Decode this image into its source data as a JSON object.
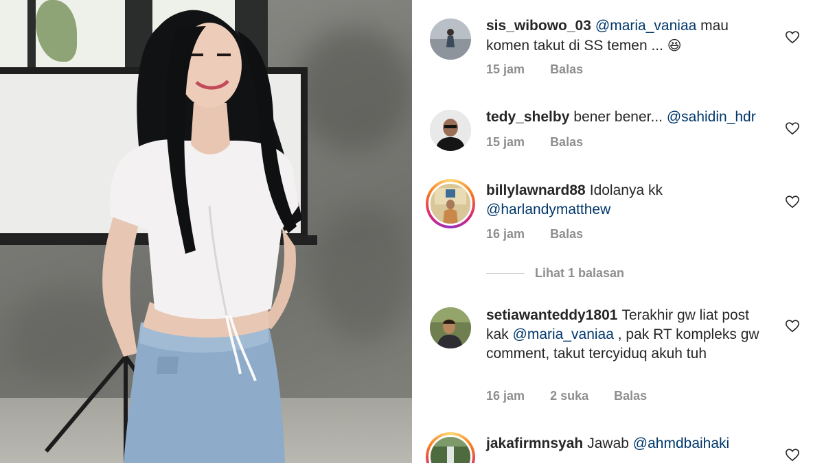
{
  "comments": [
    {
      "username": "sis_wibowo_03",
      "text_parts": [
        {
          "type": "mention",
          "text": "@maria_vaniaa"
        },
        {
          "type": "text",
          "text": " mau komen takut di SS temen ... "
        },
        {
          "type": "emoji",
          "text": "😆"
        }
      ],
      "time": "15 jam",
      "likes": "",
      "reply_label": "Balas",
      "avatar_ring": false
    },
    {
      "username": "tedy_shelby",
      "text_parts": [
        {
          "type": "text",
          "text": "bener bener... "
        },
        {
          "type": "mention",
          "text": "@sahidin_hdr"
        }
      ],
      "time": "15 jam",
      "likes": "",
      "reply_label": "Balas",
      "avatar_ring": false
    },
    {
      "username": "billylawnard88",
      "text_parts": [
        {
          "type": "text",
          "text": "Idolanya kk "
        },
        {
          "type": "mention",
          "text": "@harlandymatthew"
        }
      ],
      "time": "16 jam",
      "likes": "",
      "reply_label": "Balas",
      "avatar_ring": true
    },
    {
      "username": "setiawanteddy1801",
      "text_parts": [
        {
          "type": "text",
          "text": "Terakhir gw liat post kak "
        },
        {
          "type": "mention",
          "text": "@maria_vaniaa"
        },
        {
          "type": "text",
          "text": " , pak RT kompleks gw comment, takut tercyiduq akuh tuh"
        }
      ],
      "time": "16 jam",
      "likes": "2 suka",
      "reply_label": "Balas",
      "avatar_ring": false
    },
    {
      "username": "jakafirmnsyah",
      "text_parts": [
        {
          "type": "text",
          "text": "Jawab "
        },
        {
          "type": "mention",
          "text": "@ahmdbaihaki"
        }
      ],
      "time": "",
      "likes": "",
      "reply_label": "",
      "avatar_ring": true
    }
  ],
  "view_replies": "Lihat 1 balasan",
  "colors": {
    "text": "#262626",
    "mention": "#00376b",
    "meta": "#8e8e8e",
    "heart": "#262626"
  },
  "icons": {
    "like": "heart-outline-icon"
  }
}
